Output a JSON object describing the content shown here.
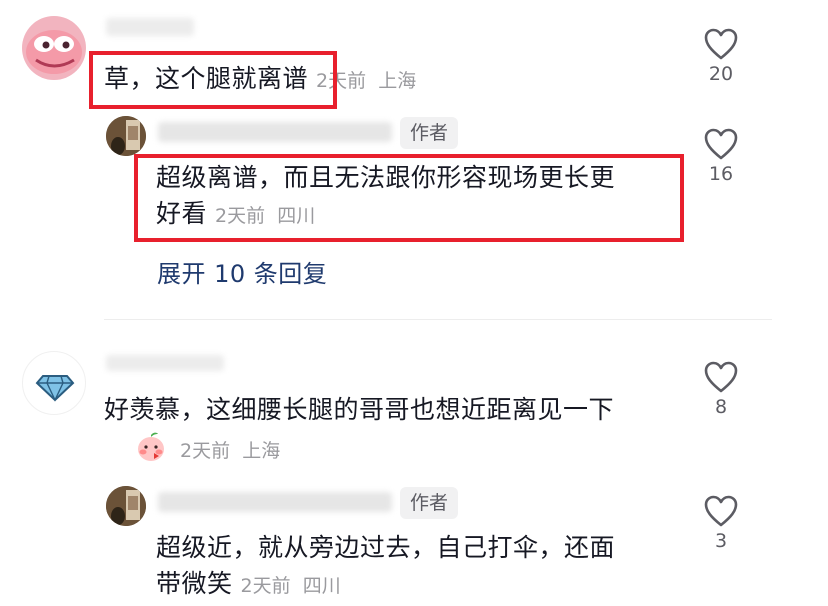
{
  "comments": [
    {
      "text": "草，这个腿就离谱",
      "time": "2天前",
      "location": "上海",
      "likes": "20"
    },
    {
      "text": "好羡慕，这细腰长腿的哥哥也想近距离见一下",
      "time": "2天前",
      "location": "上海",
      "likes": "8"
    }
  ],
  "replies": [
    {
      "author_tag": "作者",
      "text_line1": "超级离谱，而且无法跟你形容现场更长更",
      "text_line2": "好看",
      "time": "2天前",
      "location": "四川",
      "likes": "16"
    },
    {
      "author_tag": "作者",
      "text_line1": "超级近，就从旁边过去，自己打伞，还面",
      "text_line2": "带微笑",
      "time": "2天前",
      "location": "四川",
      "likes": "3"
    }
  ],
  "expand_replies": "展开 10 条回复",
  "emoji_name": "peach-face-emoji",
  "colors": {
    "highlight": "#e8202d",
    "expand_link": "#1f3a6e",
    "meta": "#9a9a9e"
  }
}
